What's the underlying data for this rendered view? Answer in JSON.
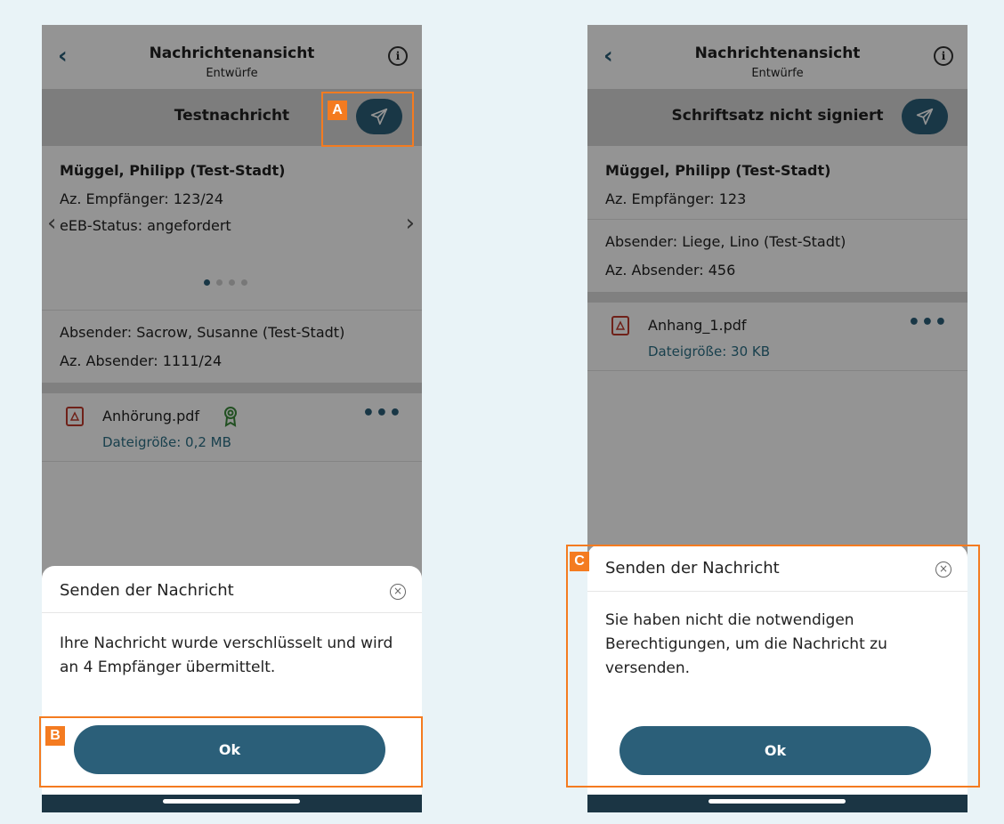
{
  "left": {
    "header": {
      "back_glyph": "‹",
      "title": "Nachrichtenansicht",
      "subtitle": "Entwürfe",
      "info_glyph": "i"
    },
    "subject": "Testnachricht",
    "recipient": {
      "name": "Müggel, Philipp (Test-Stadt)",
      "az": "Az. Empfänger: 123/24",
      "status": "eEB-Status: angefordert"
    },
    "carousel": {
      "count": 4,
      "active": 1,
      "prev_glyph": "‹",
      "next_glyph": "›"
    },
    "sender": {
      "name": "Absender: Sacrow, Susanne (Test-Stadt)",
      "az": "Az. Absender: 1111/24"
    },
    "attachment": {
      "name": "Anhörung.pdf",
      "size": "Dateigröße: 0,2 MB",
      "more_glyph": "•••"
    },
    "dialog": {
      "title": "Senden der Nachricht",
      "close_glyph": "×",
      "message": "Ihre Nachricht wurde verschlüsselt und wird an 4 Empfänger übermittelt.",
      "ok_label": "Ok"
    }
  },
  "right": {
    "header": {
      "back_glyph": "‹",
      "title": "Nachrichtenansicht",
      "subtitle": "Entwürfe",
      "info_glyph": "i"
    },
    "subject": "Schriftsatz nicht signiert",
    "recipient": {
      "name": "Müggel, Philipp (Test-Stadt)",
      "az": "Az. Empfänger: 123"
    },
    "sender": {
      "name": "Absender: Liege, Lino (Test-Stadt)",
      "az": "Az. Absender: 456"
    },
    "attachment": {
      "name": "Anhang_1.pdf",
      "size": "Dateigröße: 30 KB",
      "more_glyph": "•••"
    },
    "dialog": {
      "title": "Senden der Nachricht",
      "close_glyph": "×",
      "message": "Sie haben nicht die notwendigen Berechtigungen, um die Nachricht zu versenden.",
      "ok_label": "Ok"
    }
  },
  "callouts": {
    "a": "A",
    "b": "B",
    "c": "C"
  },
  "colors": {
    "primary": "#2b5f79",
    "accent": "#f47b20",
    "pdf_red": "#c0392b",
    "badge_green": "#3b8a3b",
    "link": "#2b6f86"
  }
}
